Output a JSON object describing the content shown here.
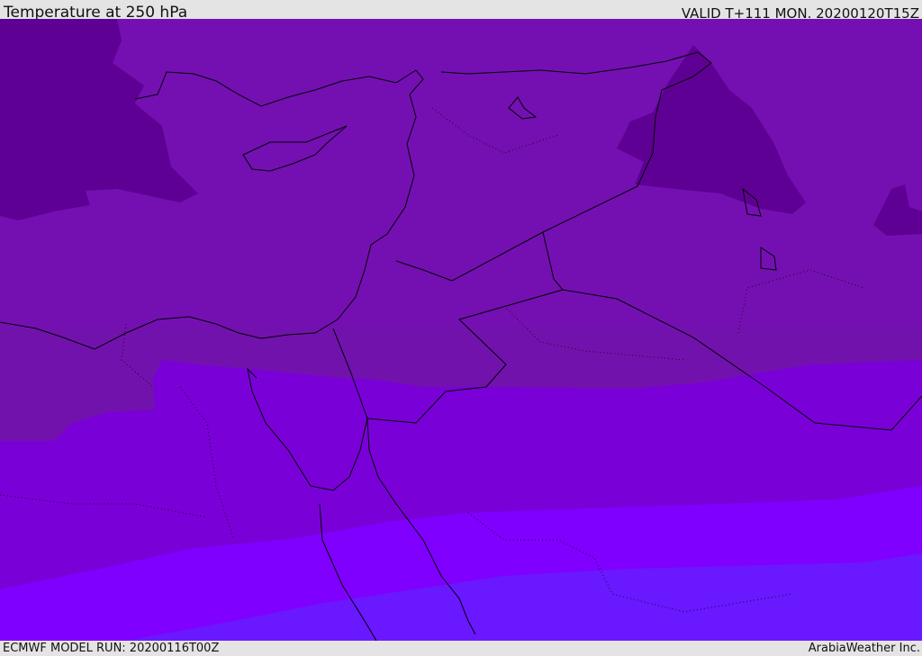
{
  "header": {
    "title": "Temperature at 250 hPa",
    "valid": "VALID T+111 MON. 20200120T15Z"
  },
  "footer": {
    "model_run": "ECMWF MODEL RUN: 20200116T00Z",
    "credit": "ArabiaWeather Inc."
  },
  "colors": {
    "coldest": "#5f0094",
    "cold": "#7410b2",
    "mid": "#7a00d8",
    "warm": "#7f00ff",
    "warmest": "#6a18ff",
    "coast": "#000000"
  }
}
